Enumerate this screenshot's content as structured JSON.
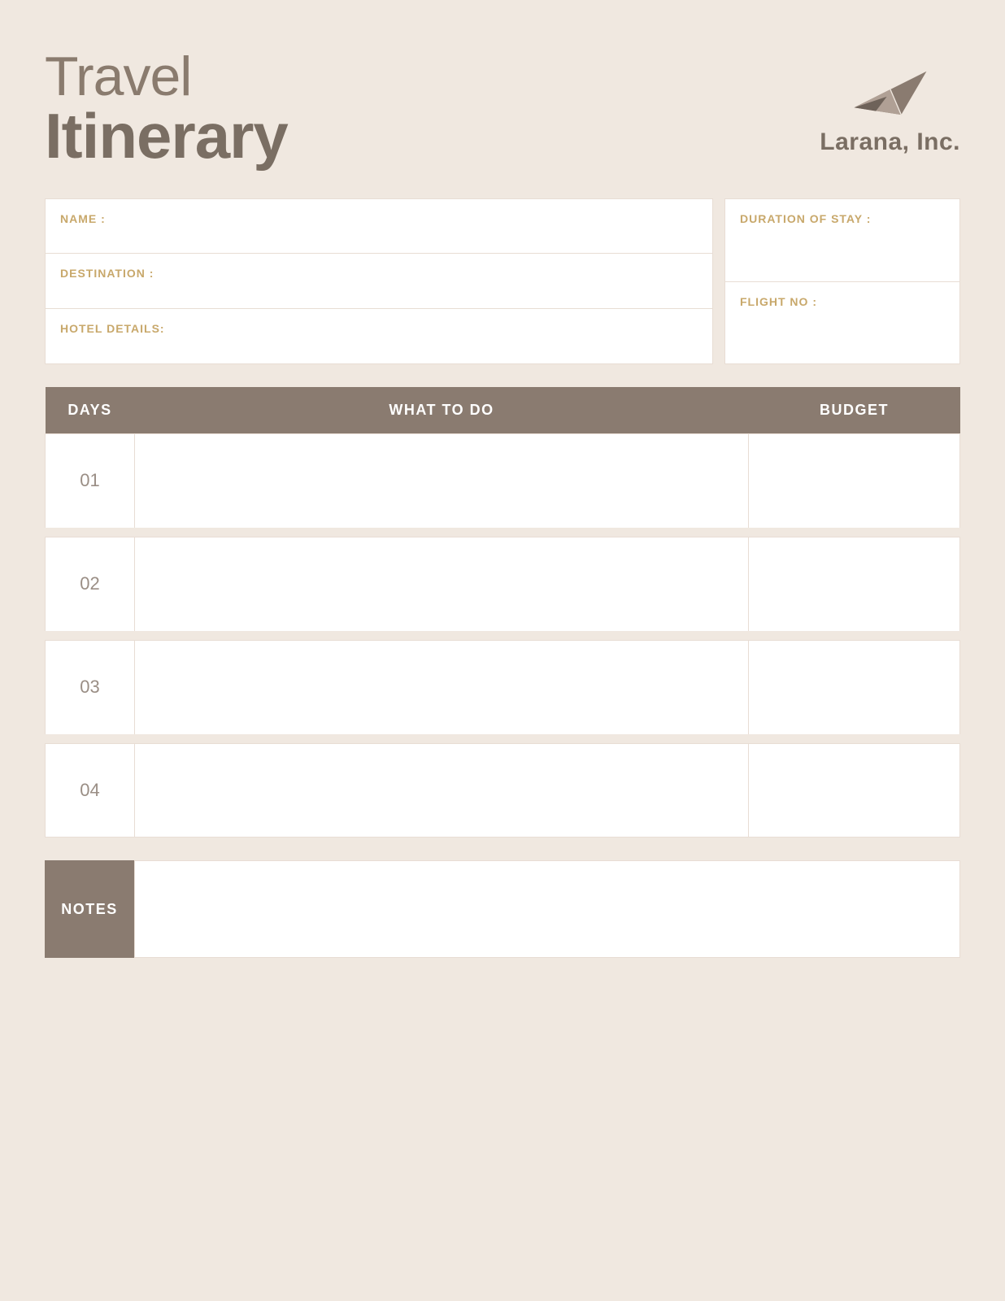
{
  "header": {
    "title_line1": "Travel",
    "title_line2": "Itinerary",
    "company_name": "Larana, Inc."
  },
  "info_fields": {
    "name_label": "NAME :",
    "destination_label": "DESTINATION :",
    "hotel_label": "HOTEL DETAILS:",
    "duration_label": "DURATION OF STAY :",
    "flight_label": "FLIGHT NO :"
  },
  "table": {
    "col_days": "DAYS",
    "col_what": "WHAT TO DO",
    "col_budget": "BUDGET",
    "rows": [
      {
        "day": "01"
      },
      {
        "day": "02"
      },
      {
        "day": "03"
      },
      {
        "day": "04"
      }
    ]
  },
  "notes": {
    "label": "NOTES"
  }
}
